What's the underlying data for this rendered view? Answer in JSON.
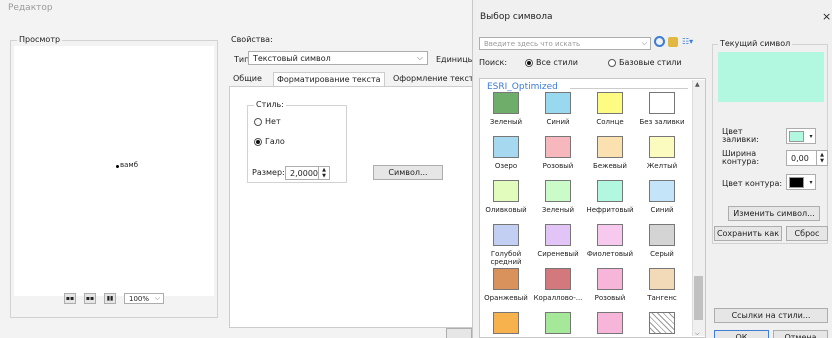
{
  "window_title": "Редактор",
  "preview": {
    "title": "Просмотр",
    "sample_text": "вамб",
    "zoom": "100%"
  },
  "properties": {
    "title": "Свойства:",
    "type_label": "Тип:",
    "type_value": "Текстовый символ",
    "units_label": "Единицы",
    "tabs": [
      "Общие",
      "Форматирование текста",
      "Оформление текста"
    ],
    "style_label": "Стиль:",
    "style_options": [
      "Нет",
      "Гало"
    ],
    "size_label": "Размер:",
    "size_value": "2,0000",
    "symbol_button": "Символ..."
  },
  "selector": {
    "title": "Выбор символа",
    "close": "×",
    "search_placeholder": "Введите здесь что искать",
    "search_label": "Поиск:",
    "search_scopes": [
      "Все стили",
      "Базовые стили"
    ],
    "group_name": "ESRI_Optimized",
    "symbols": [
      {
        "label": "Зеленый",
        "color": "#6fae6a"
      },
      {
        "label": "Синий",
        "color": "#99d9ef"
      },
      {
        "label": "Солнце",
        "color": "#fdfb82"
      },
      {
        "label": "Без заливки",
        "color": "#ffffff"
      },
      {
        "label": "Озеро",
        "color": "#a6d8f0"
      },
      {
        "label": "Розовый",
        "color": "#f7b8bd"
      },
      {
        "label": "Бежевый",
        "color": "#fce1b0"
      },
      {
        "label": "Желтый",
        "color": "#fcfbbf"
      },
      {
        "label": "Оливковый",
        "color": "#e2fcbe"
      },
      {
        "label": "Зеленый",
        "color": "#cafbc9"
      },
      {
        "label": "Нефритовый",
        "color": "#b2f8e0"
      },
      {
        "label": "Синий",
        "color": "#c3e4f9"
      },
      {
        "label": "Голубой средний",
        "color": "#c2cff3"
      },
      {
        "label": "Сиреневый",
        "color": "#e2c4f6"
      },
      {
        "label": "Фиолетовый",
        "color": "#f8c9ef"
      },
      {
        "label": "Серый",
        "color": "#d4d4d4"
      },
      {
        "label": "Оранжевый",
        "color": "#d9925c"
      },
      {
        "label": "Кораллово-...",
        "color": "#d3787c"
      },
      {
        "label": "Розовый",
        "color": "#f7b5d9"
      },
      {
        "label": "Тангенс",
        "color": "#f2dab8"
      },
      {
        "label": "",
        "color": "#f7b24e"
      },
      {
        "label": "",
        "color": "#a6e89a"
      },
      {
        "label": "",
        "color": "#f7b5d9"
      },
      {
        "label": "",
        "color": "hatched"
      }
    ],
    "current_label": "Текущий символ",
    "current_color": "#b2f8e0",
    "fill_label": "Цвет заливки:",
    "fill_color": "#b2f8e0",
    "width_label": "Ширина контура:",
    "width_value": "0,00",
    "outline_label": "Цвет контура:",
    "outline_color": "#000000",
    "edit_button": "Изменить символ...",
    "save_button": "Сохранить как",
    "reset_button": "Сброс",
    "style_refs_button": "Ссылки на стили...",
    "ok_button": "ОК",
    "cancel_button": "Отмена"
  }
}
